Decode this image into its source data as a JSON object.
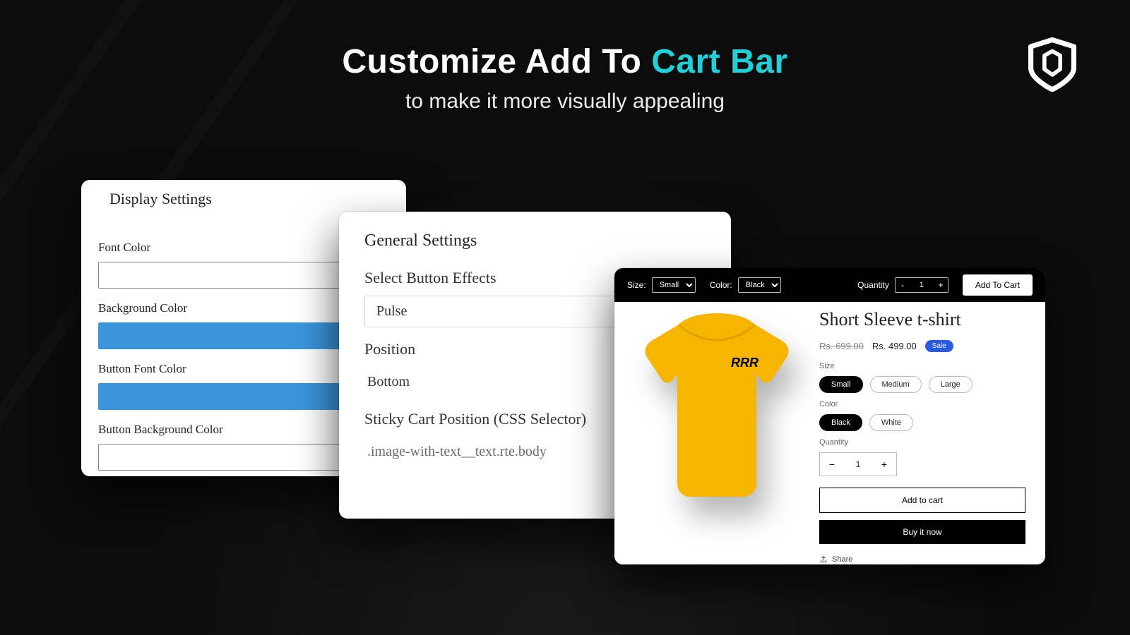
{
  "headline": {
    "part1": "Customize Add To ",
    "part2_accent": "Cart Bar",
    "subtitle": "to make it more visually appealing"
  },
  "colors": {
    "accent": "#1fd0d8",
    "swatch_blue": "#3a95dc"
  },
  "display_settings": {
    "title": "Display Settings",
    "fields": {
      "font_color": "Font Color",
      "background_color": "Background Color",
      "button_font_color": "Button Font Color",
      "button_background_color": "Button Background Color"
    }
  },
  "general_settings": {
    "title": "General Settings",
    "labels": {
      "button_effects": "Select Button Effects",
      "position": "Position",
      "sticky_css": "Sticky Cart Position (CSS Selector)"
    },
    "values": {
      "button_effects": "Pulse",
      "position": "Bottom",
      "sticky_css": ".image-with-text__text.rte.body"
    }
  },
  "sticky_bar": {
    "size_label": "Size:",
    "size_value": "Small",
    "color_label": "Color:",
    "color_value": "Black",
    "quantity_label": "Quantity",
    "quantity_value": "1",
    "add_to_cart": "Add To Cart"
  },
  "product": {
    "title": "Short Sleeve t-shirt",
    "price_old": "Rs. 699.00",
    "price_new": "Rs. 499.00",
    "sale_badge": "Sale",
    "size_label": "Size",
    "sizes": [
      "Small",
      "Medium",
      "Large"
    ],
    "size_selected": "Small",
    "color_label": "Color",
    "colors_list": [
      "Black",
      "White"
    ],
    "color_selected": "Black",
    "quantity_label": "Quantity",
    "quantity_value": "1",
    "add_to_cart": "Add to cart",
    "buy_now": "Buy it now",
    "share": "Share",
    "shirt_logo": "RRR"
  }
}
